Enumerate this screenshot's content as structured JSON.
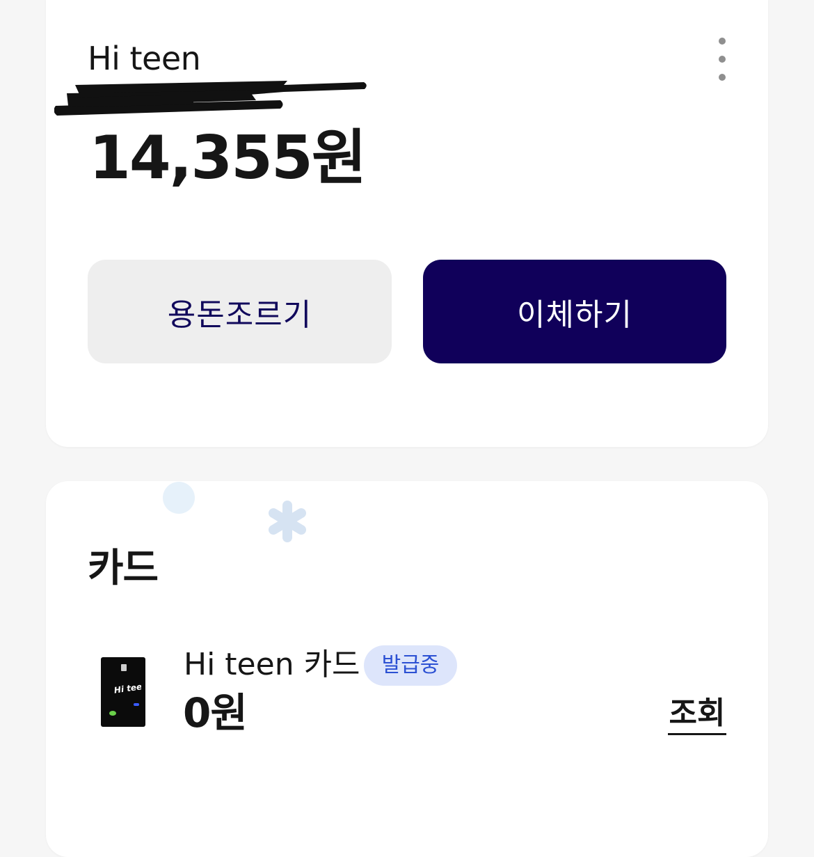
{
  "account": {
    "name": "Hi teen",
    "balance": "14,355원",
    "request_allowance_label": "용돈조르기",
    "transfer_label": "이체하기"
  },
  "cards": {
    "section_title": "카드",
    "item": {
      "name": "Hi teen 카드",
      "status": "발급중",
      "amount": "0원",
      "view_label": "조회",
      "thumbnail_text": "Hi teen"
    }
  },
  "colors": {
    "primary_navy": "#10005a",
    "secondary_button_bg": "#eeeeee",
    "badge_bg": "#dde5fb",
    "badge_text": "#2b50d3",
    "page_bg": "#f6f6f6"
  }
}
